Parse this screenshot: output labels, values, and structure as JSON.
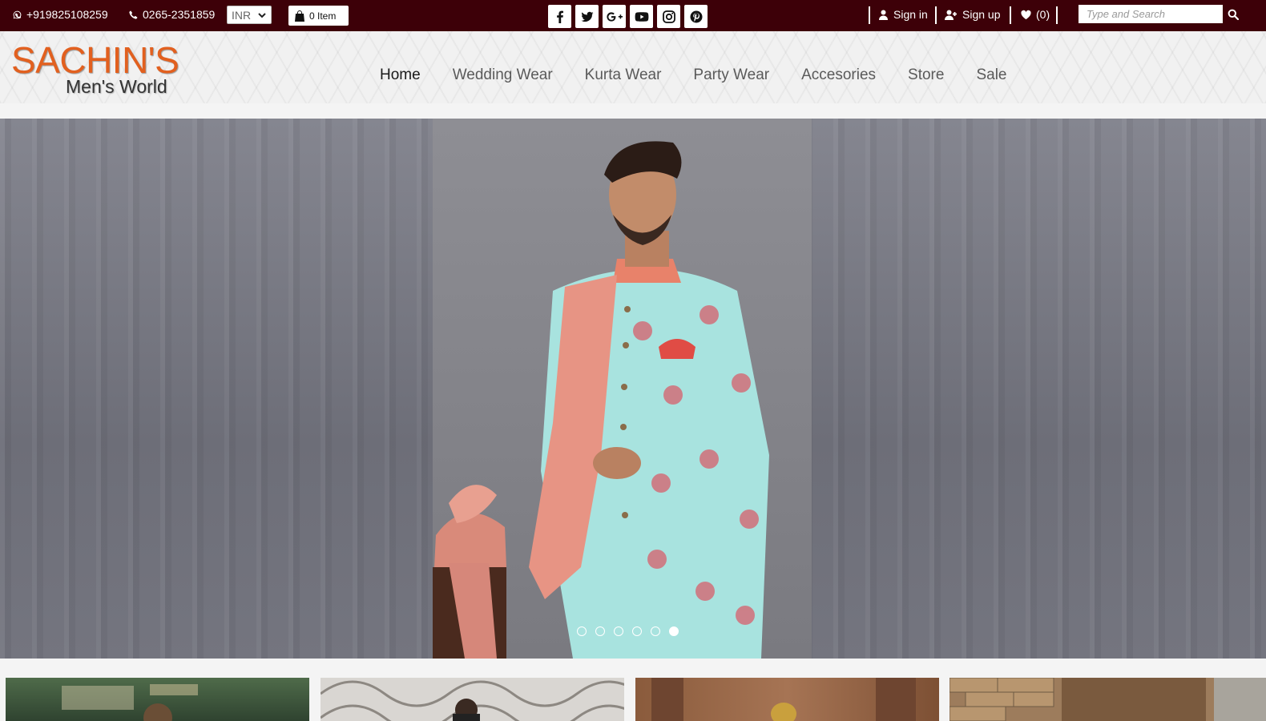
{
  "topbar": {
    "whatsapp": "+919825108259",
    "phone": "0265-2351859",
    "currency": "INR",
    "cart_label": "0 Item",
    "socials": [
      "facebook-icon",
      "twitter-icon",
      "google-plus-icon",
      "youtube-icon",
      "instagram-icon",
      "pinterest-icon"
    ],
    "signin": "Sign in",
    "signup": "Sign up",
    "wishlist": "(0)",
    "search_placeholder": "Type and Search"
  },
  "header": {
    "logo_line1": "SACHIN'S",
    "logo_line2": "Men's World",
    "nav": [
      "Home",
      "Wedding Wear",
      "Kurta Wear",
      "Party Wear",
      "Accesories",
      "Store",
      "Sale"
    ],
    "active_nav": "Home"
  },
  "hero": {
    "slides": 6,
    "active_slide": 6
  },
  "colors": {
    "topbar": "#3d0008",
    "logo_orange": "#e2601f",
    "sherwani": "#a8e3df",
    "dupatta": "#e79484"
  }
}
